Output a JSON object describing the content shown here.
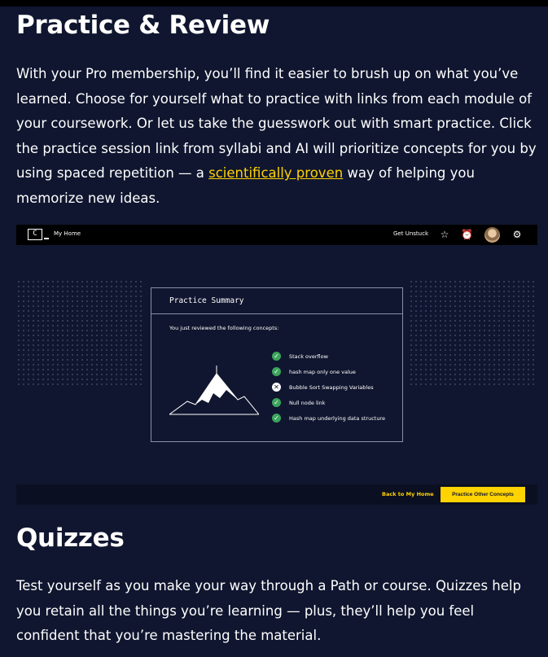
{
  "practice": {
    "heading": "Practice & Review",
    "text_before_link": "With your Pro membership, you’ll find it easier to brush up on what you’ve learned. Choose for yourself what to practice with links from each module of your coursework. Or let us take the guesswork out with smart practice. Click the practice session link from syllabi and AI will prioritize concepts for you by using spaced repetition — a ",
    "link_text": "scientifically proven",
    "text_after_link": " way of helping you memorize new ideas."
  },
  "screenshot": {
    "logo": "C",
    "nav": {
      "home": "My Home",
      "get_unstuck": "Get Unstuck"
    },
    "icons": {
      "star": "star-icon",
      "alarm": "alarm-icon",
      "avatar": "avatar",
      "gear": "gear-icon"
    },
    "card": {
      "title": "Practice Summary",
      "subtitle": "You just reviewed the following concepts:",
      "concepts": [
        {
          "label": "Stack overflow",
          "status": "check"
        },
        {
          "label": "hash map only one value",
          "status": "check"
        },
        {
          "label": "Bubble Sort Swapping Variables",
          "status": "x"
        },
        {
          "label": "Null node link",
          "status": "check"
        },
        {
          "label": "Hash map underlying data structure",
          "status": "check"
        }
      ]
    },
    "footer": {
      "back": "Back to My Home",
      "cta": "Practice Other Concepts"
    }
  },
  "quizzes": {
    "heading": "Quizzes",
    "text": "Test yourself as you make your way through a Path or course. Quizzes help you retain all the things you’re learning — plus, they’ll help you feel confident that you’re mastering the material."
  },
  "colors": {
    "background": "#10162f",
    "accent": "#ffd300",
    "success": "#3ba55c"
  }
}
